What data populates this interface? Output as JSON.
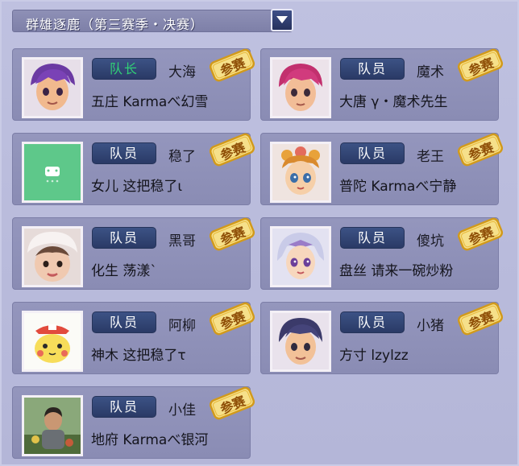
{
  "title": "群雄逐鹿（第三赛季・决赛）",
  "stamp_label": "参赛",
  "colors": {
    "captain_role": "#31d076",
    "member_role": "#ffffff",
    "stamp": "#e8b92a"
  },
  "members": [
    {
      "role": "队长",
      "nickname": "大海",
      "school": "五庄",
      "player": "Karmaべ幻雪",
      "avatar": "purple-hair-warrior"
    },
    {
      "role": "队员",
      "nickname": "魔术",
      "school": "大唐",
      "player": "γ・魔术先生",
      "avatar": "red-hair-warrior"
    },
    {
      "role": "队员",
      "nickname": "稳了",
      "school": "女儿",
      "player": "这把稳了ι",
      "avatar": "green-sheep-icon"
    },
    {
      "role": "队员",
      "nickname": "老王",
      "school": "普陀",
      "player": "Karmaべ宁静",
      "avatar": "flower-girl"
    },
    {
      "role": "队员",
      "nickname": "黑哥",
      "school": "化生",
      "player": "荡漾`",
      "avatar": "baby-photo"
    },
    {
      "role": "队员",
      "nickname": "傻坑",
      "school": "盘丝",
      "player": "请来一碗炒粉",
      "avatar": "silver-hair-girl"
    },
    {
      "role": "队员",
      "nickname": "阿柳",
      "school": "神木",
      "player": "这把稳了τ",
      "avatar": "pikachu-drawing"
    },
    {
      "role": "队员",
      "nickname": "小猪",
      "school": "方寸",
      "player": "lzylzz",
      "avatar": "black-hair-boy"
    },
    {
      "role": "队员",
      "nickname": "小佳",
      "school": "地府",
      "player": "Karmaべ银河",
      "avatar": "man-photo"
    }
  ]
}
